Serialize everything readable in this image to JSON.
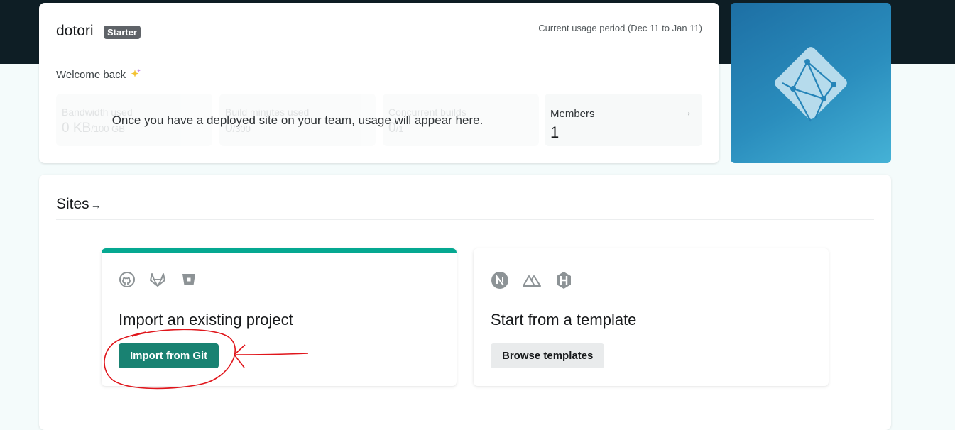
{
  "team": {
    "name": "dotori",
    "plan": "Starter",
    "usage_period": "Current usage period (Dec 11 to Jan 11)",
    "welcome": "Welcome back"
  },
  "usage": {
    "overlay_message": "Once you have a deployed site on your team, usage will appear here.",
    "stats": [
      {
        "label": "Bandwidth used",
        "value": "0 KB",
        "limit": "/100 GB"
      },
      {
        "label": "Build minutes used",
        "value": "0",
        "limit": "/300"
      },
      {
        "label": "Concurrent builds",
        "value": "0",
        "limit": "/1"
      }
    ],
    "members": {
      "label": "Members",
      "value": "1",
      "arrow": "→"
    }
  },
  "sites": {
    "title": "Sites",
    "arrow": "→",
    "import": {
      "title": "Import an existing project",
      "button": "Import from Git",
      "icons": [
        "github-icon",
        "gitlab-icon",
        "bitbucket-icon"
      ]
    },
    "template": {
      "title": "Start from a template",
      "button": "Browse templates",
      "icons": [
        "nextjs-icon",
        "nuxt-icon",
        "hugo-icon"
      ]
    }
  },
  "colors": {
    "top_band": "#0e1e25",
    "accent_bar": "#05a891",
    "primary_button": "#198272",
    "annotation": "#e0151b"
  }
}
